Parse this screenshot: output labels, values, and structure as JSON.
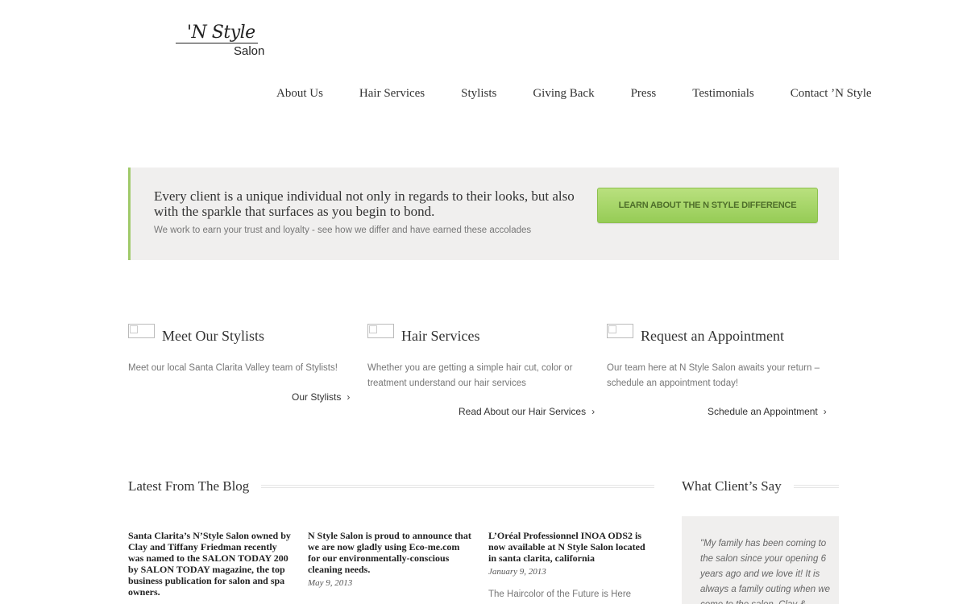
{
  "logo": {
    "line1": "'N Style",
    "line2": "Salon"
  },
  "nav": [
    {
      "label": "About Us"
    },
    {
      "label": "Hair Services"
    },
    {
      "label": "Stylists"
    },
    {
      "label": "Giving Back"
    },
    {
      "label": "Press"
    },
    {
      "label": "Testimonials"
    },
    {
      "label": "Contact ’N Style"
    }
  ],
  "promo": {
    "title": "Every client is a unique individual not only in regards to their looks, but also with the sparkle that surfaces as you begin to bond.",
    "subtitle": "We work to earn your trust and loyalty - see how we differ and have earned these accolades",
    "button": "LEARN ABOUT THE N STYLE DIFFERENCE",
    "accent_color": "#a0ca6a"
  },
  "features": [
    {
      "title": "Meet Our Stylists",
      "text": "Meet our local Santa Clarita Valley team of Stylists!",
      "link": "Our Stylists",
      "chevron": "›"
    },
    {
      "title": "Hair Services",
      "text": "Whether you are getting a simple hair cut, color or treatment understand our hair services",
      "link": "Read About our Hair Services",
      "chevron": "›"
    },
    {
      "title": "Request an Appointment",
      "text": "Our team here at N Style Salon awaits your return – schedule an appointment today!",
      "link": "Schedule an Appointment",
      "chevron": "›"
    }
  ],
  "blog": {
    "heading": "Latest From The Blog",
    "posts": [
      {
        "title": "Santa Clarita’s N’Style Salon owned by Clay and Tiffany Friedman recently was named to the SALON TODAY 200 by SALON TODAY magazine, the top business publication for salon and spa owners.",
        "date": "",
        "excerpt": ""
      },
      {
        "title": "N Style Salon is proud to announce that we are now gladly using Eco-me.com for our environmentally-conscious cleaning needs.",
        "date": "May 9, 2013",
        "excerpt": ""
      },
      {
        "title": "L’Oréal Professionnel INOA ODS2 is now available at N Style Salon located in santa clarita, california",
        "date": "January 9, 2013",
        "excerpt": "The Haircolor of the Future is Here"
      }
    ]
  },
  "testimonials": {
    "heading": "What Client’s Say",
    "quote": "\"My family has been coming to the salon since your opening 6 years ago and we love it! It is always a family outing when we come to the salon. Clay &"
  }
}
